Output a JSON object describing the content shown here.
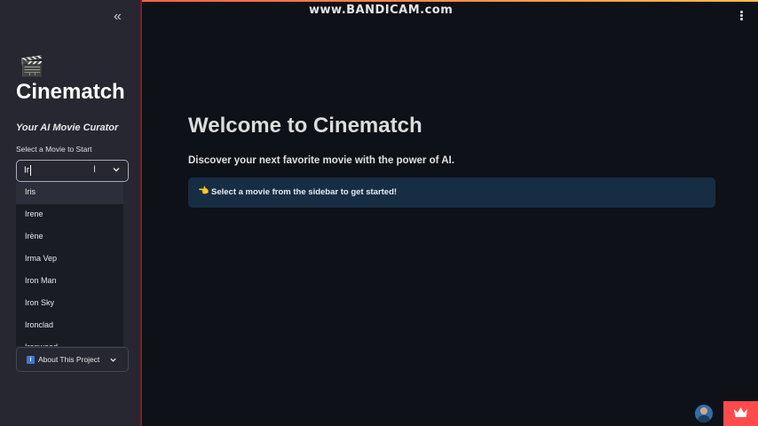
{
  "watermark": "www.BANDICAM.com",
  "sidebar": {
    "collapse_glyph": "«",
    "logo_glyph": "🎬",
    "title": "Cinematch",
    "subtitle": "Your AI Movie Curator",
    "select_label": "Select a Movie to Start",
    "select_value": "Ir",
    "options": [
      "Iris",
      "Irene",
      "Irène",
      "Irma Vep",
      "Iron Man",
      "Iron Sky",
      "Ironclad",
      "Ironweed"
    ],
    "about": {
      "icon_glyph": "i",
      "label": "About This Project"
    }
  },
  "main": {
    "title": "Welcome to Cinematch",
    "subtitle": "Discover your next favorite movie with the power of AI.",
    "info": {
      "icon_glyph": "👈",
      "text": "Select a movie from the sidebar to get started!"
    }
  },
  "colors": {
    "background": "#0e1117",
    "sidebar": "#262730",
    "info_box": "#172d43",
    "accent": "#ff4b4b"
  }
}
